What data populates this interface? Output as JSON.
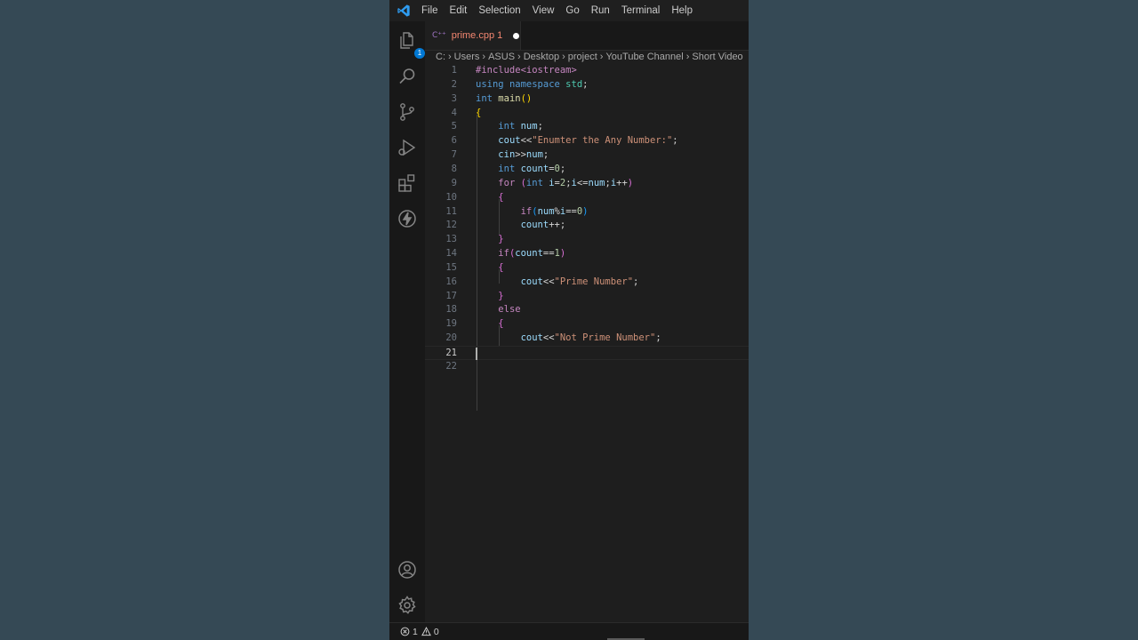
{
  "menu": [
    "File",
    "Edit",
    "Selection",
    "View",
    "Go",
    "Run",
    "Terminal",
    "Help"
  ],
  "activity_badge": "1",
  "tab": {
    "icon": "C⁺⁺",
    "filename": "prime.cpp",
    "problems": "1"
  },
  "breadcrumb": [
    "C:",
    "Users",
    "ASUS",
    "Desktop",
    "project",
    "YouTube Channel",
    "Short Video"
  ],
  "code_lines": [
    {
      "n": "1",
      "text": "#include<iostream>"
    },
    {
      "n": "2",
      "text": "using namespace std;"
    },
    {
      "n": "3",
      "text": "int main()"
    },
    {
      "n": "4",
      "text": "{"
    },
    {
      "n": "5",
      "text": "    int num;"
    },
    {
      "n": "6",
      "text": "    cout<<\"Enumter the Any Number:\";"
    },
    {
      "n": "7",
      "text": "    cin>>num;"
    },
    {
      "n": "8",
      "text": "    int count=0;"
    },
    {
      "n": "9",
      "text": "    for (int i=2;i<=num;i++)"
    },
    {
      "n": "10",
      "text": "    {"
    },
    {
      "n": "11",
      "text": "        if(num%i==0)"
    },
    {
      "n": "12",
      "text": "        count++;"
    },
    {
      "n": "13",
      "text": "    }"
    },
    {
      "n": "14",
      "text": "    if(count==1)"
    },
    {
      "n": "15",
      "text": "    {"
    },
    {
      "n": "16",
      "text": "        cout<<\"Prime Number\";"
    },
    {
      "n": "17",
      "text": "    }"
    },
    {
      "n": "18",
      "text": "    else"
    },
    {
      "n": "19",
      "text": "    {"
    },
    {
      "n": "20",
      "text": "        cout<<\"Not Prime Number\";"
    },
    {
      "n": "21",
      "text": ""
    },
    {
      "n": "22",
      "text": ""
    }
  ],
  "active_line": "21",
  "status": {
    "errors": "1",
    "warnings": "0"
  },
  "colors": {
    "accent": "#0078d4",
    "error_text": "#f48771"
  }
}
